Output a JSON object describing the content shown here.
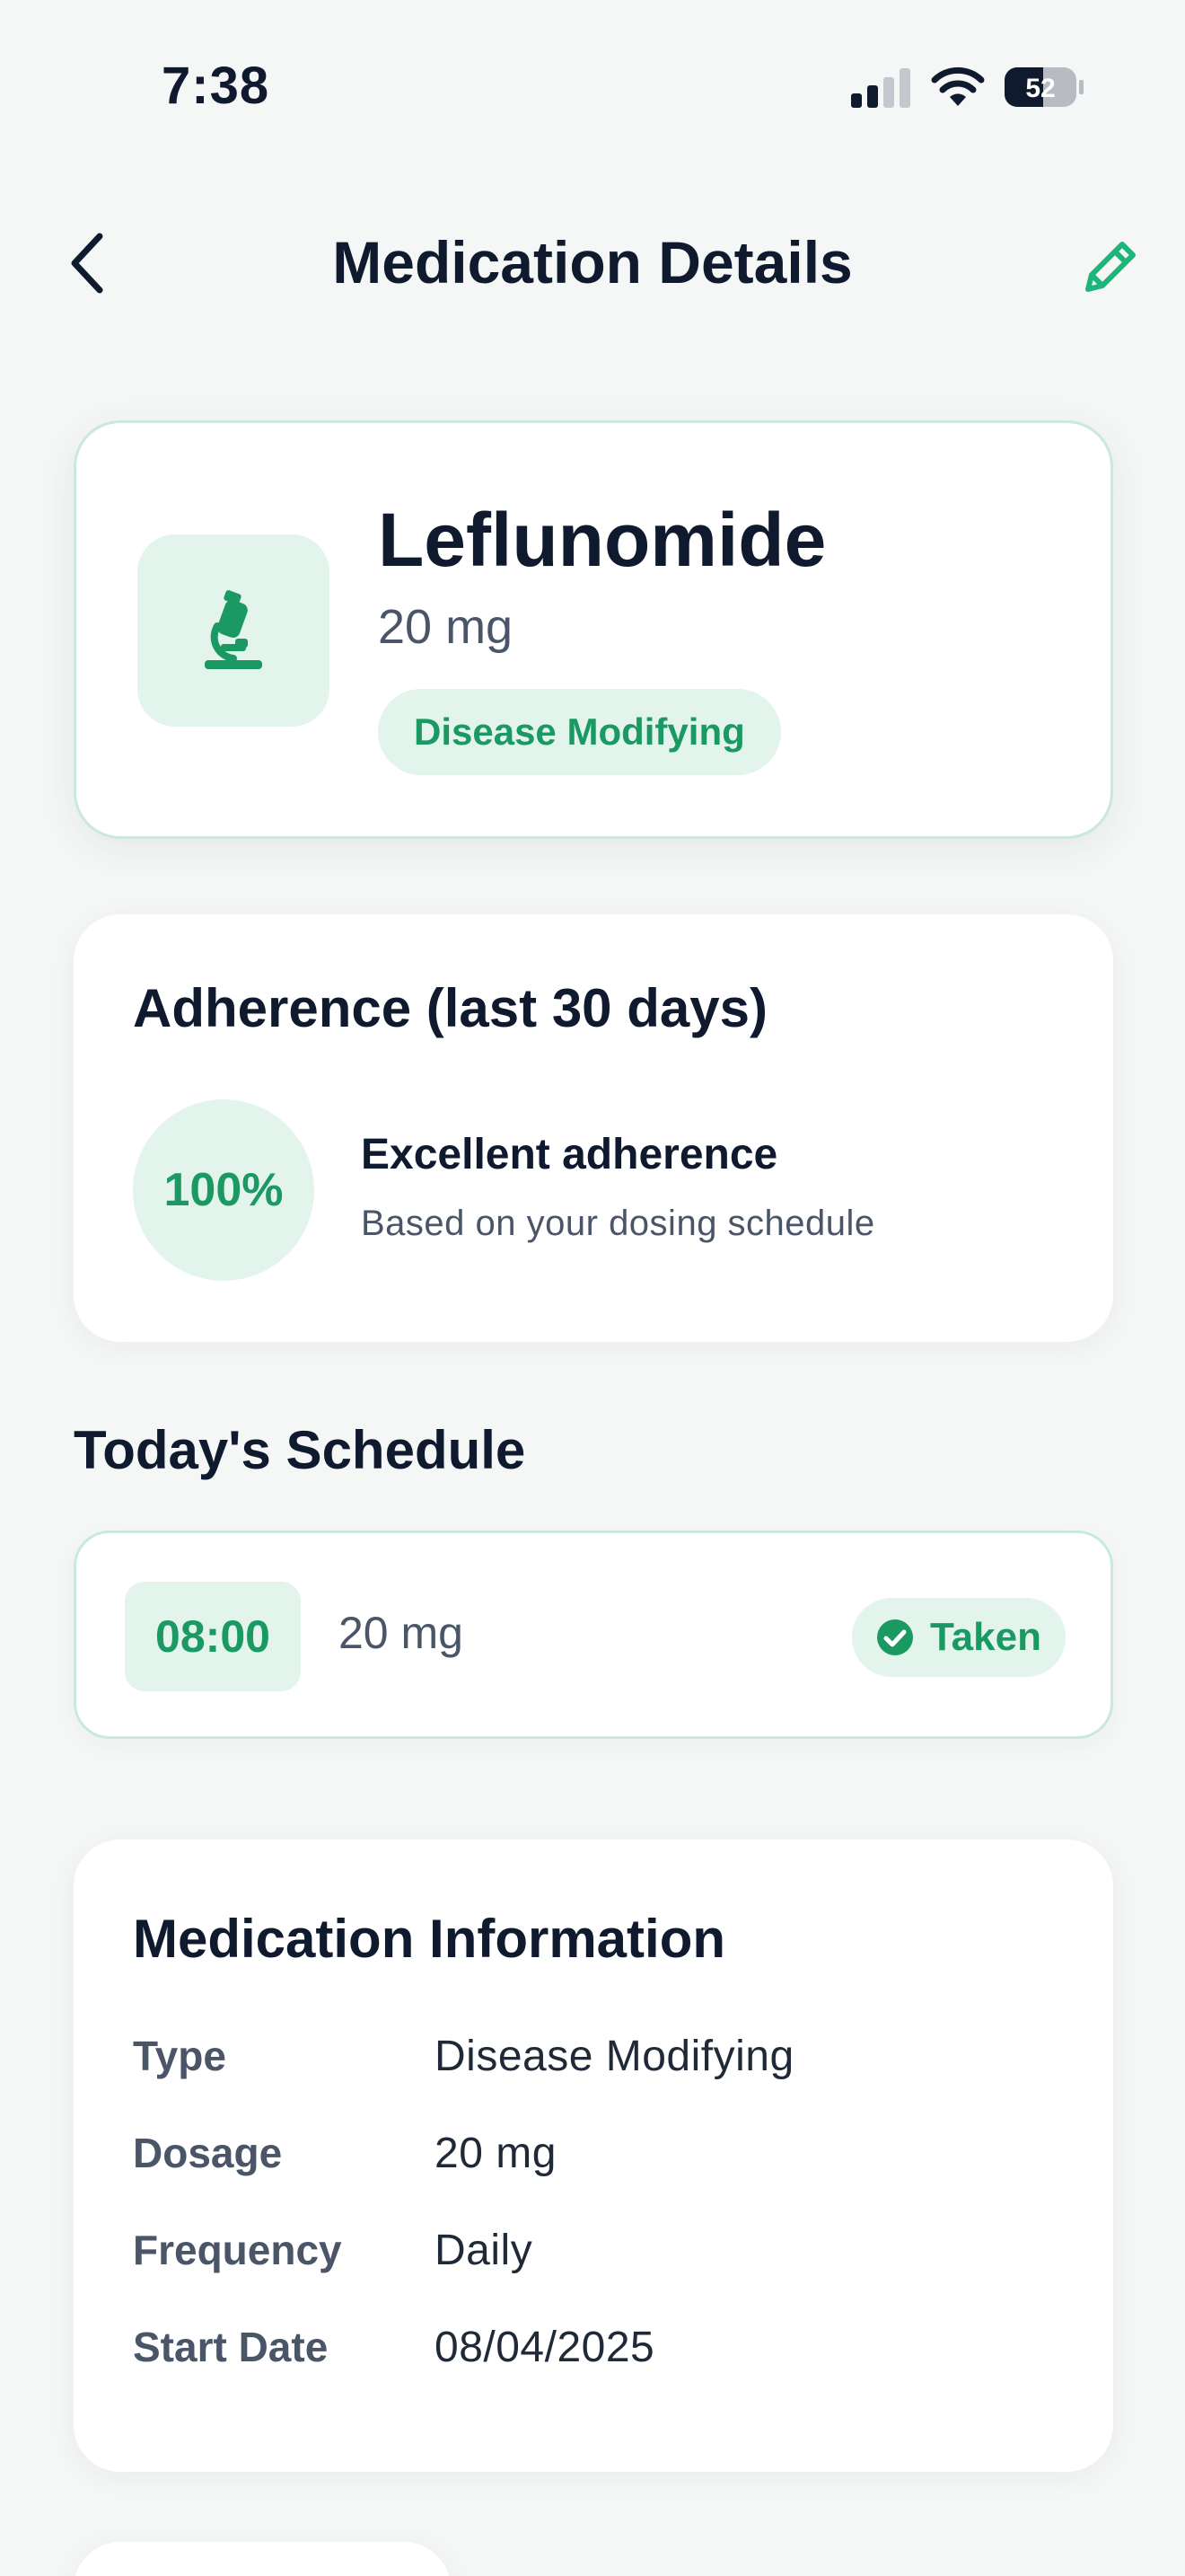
{
  "status_bar": {
    "time": "7:38",
    "battery": "52"
  },
  "header": {
    "title": "Medication Details"
  },
  "medication": {
    "name": "Leflunomide",
    "dose": "20 mg",
    "category": "Disease Modifying",
    "icon": "microscope-icon"
  },
  "adherence": {
    "title": "Adherence (last 30 days)",
    "percent": "100%",
    "label": "Excellent adherence",
    "sub": "Based on your dosing schedule"
  },
  "schedule": {
    "title": "Today's Schedule",
    "items": [
      {
        "time": "08:00",
        "dose": "20 mg",
        "status": "Taken"
      }
    ]
  },
  "info": {
    "title": "Medication Information",
    "rows": [
      {
        "key": "Type",
        "value": "Disease Modifying"
      },
      {
        "key": "Dosage",
        "value": "20 mg"
      },
      {
        "key": "Frequency",
        "value": "Daily"
      },
      {
        "key": "Start Date",
        "value": "08/04/2025"
      }
    ]
  },
  "colors": {
    "accent": "#1A9A62",
    "accent_bg": "#E3F4EC",
    "card_border": "#C9E9DB",
    "background": "#F5F7F6"
  }
}
